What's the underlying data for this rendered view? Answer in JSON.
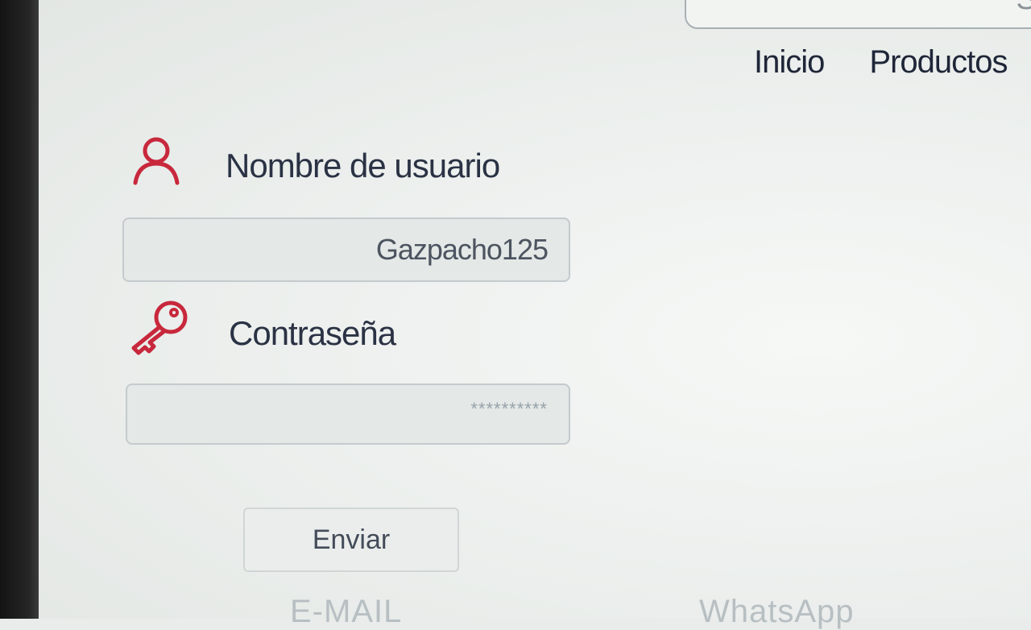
{
  "header": {
    "search_partial_text": "Se",
    "nav": [
      {
        "label": "Inicio"
      },
      {
        "label": "Productos"
      }
    ]
  },
  "login": {
    "username_label": "Nombre de usuario",
    "username_value": "Gazpacho125",
    "password_label": "Contraseña",
    "password_value": "**********",
    "submit_label": "Enviar"
  },
  "footer": {
    "email_label": "E-MAIL",
    "whatsapp_label": "WhatsApp"
  },
  "colors": {
    "icon_accent": "#c8283c",
    "text": "#2a3244",
    "background": "#eef1ef"
  },
  "icons": {
    "user": "user-icon",
    "key": "key-icon"
  }
}
